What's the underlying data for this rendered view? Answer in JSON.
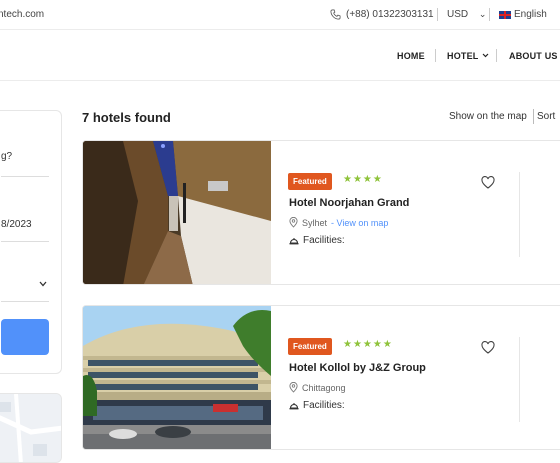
{
  "topbar": {
    "email": "ntech.com",
    "phone": "(+88) 01322303131",
    "currency": "USD",
    "currency_caret": "⌄",
    "language": "English"
  },
  "nav": {
    "home": "HOME",
    "hotel": "HOTEL",
    "about": "ABOUT US"
  },
  "sidebar": {
    "question": "g?",
    "date": "8/2023"
  },
  "results": {
    "title": "7 hotels found",
    "map_link": "Show on the map",
    "sort": "Sort"
  },
  "hotels": [
    {
      "badge": "Featured",
      "stars": "★★★★",
      "name": "Hotel Noorjahan Grand",
      "city": "Sylhet",
      "view_link": " - View on map",
      "facilities": "Facilities:"
    },
    {
      "badge": "Featured",
      "stars": "★★★★★",
      "name": "Hotel Kollol by J&Z Group",
      "city": "Chittagong",
      "view_link": "",
      "facilities": "Facilities:"
    }
  ],
  "colors": {
    "accent": "#5191fa",
    "badge": "#e0571f",
    "stars": "#8fc33a"
  }
}
